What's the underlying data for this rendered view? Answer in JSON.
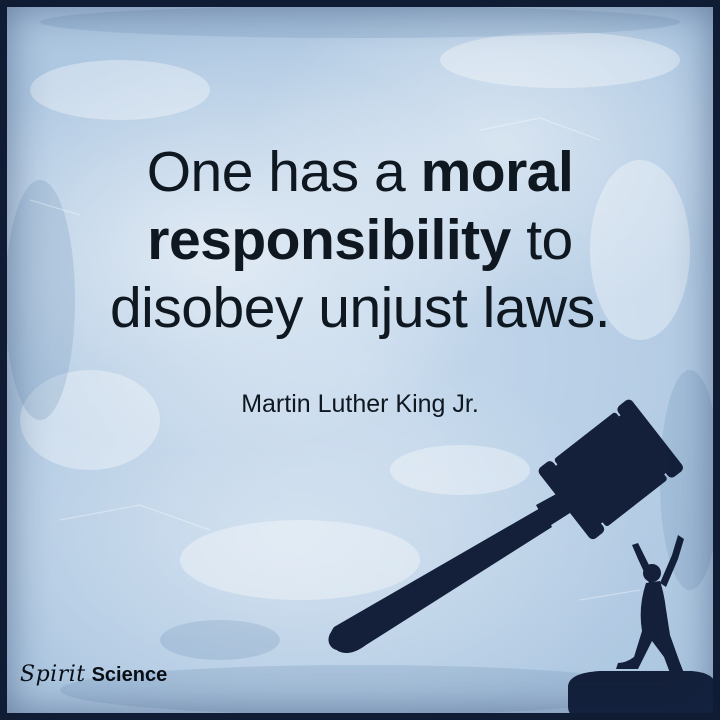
{
  "quote": {
    "line1_a": "One has a ",
    "line1_b": "moral",
    "line2_a": "responsibility",
    "line2_b": " to",
    "line3": "disobey unjust laws."
  },
  "author": "Martin Luther King Jr.",
  "logo": {
    "spirit": "Spirit",
    "science": "Science"
  },
  "colors": {
    "background": "#b3cbe3",
    "text": "#0f1720",
    "silhouette": "#14203a",
    "frame": "#0f1c33"
  }
}
